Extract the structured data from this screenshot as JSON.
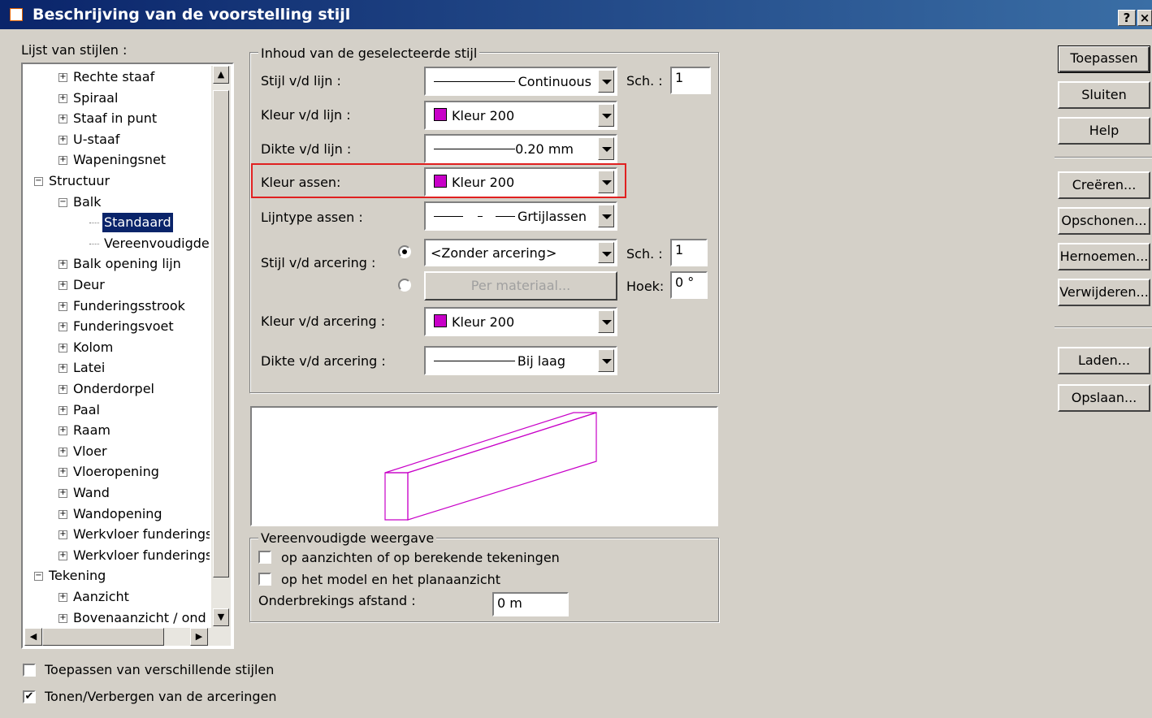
{
  "window": {
    "title": "Beschrijving van de voorstelling stijl",
    "help_btn": "?",
    "close_btn": "×"
  },
  "style_list": {
    "label": "Lijst van stijlen :",
    "items": [
      {
        "text": "Rechte staaf",
        "level": 2,
        "exp": "+"
      },
      {
        "text": "Spiraal",
        "level": 2,
        "exp": "+"
      },
      {
        "text": "Staaf in punt",
        "level": 2,
        "exp": "+"
      },
      {
        "text": "U-staaf",
        "level": 2,
        "exp": "+"
      },
      {
        "text": "Wapeningsnet",
        "level": 2,
        "exp": "+"
      },
      {
        "text": "Structuur",
        "level": 1,
        "exp": "−"
      },
      {
        "text": "Balk",
        "level": 2,
        "exp": "−"
      },
      {
        "text": "Standaard",
        "level": 3,
        "exp": "",
        "selected": true
      },
      {
        "text": "Vereenvoudigde",
        "level": 3,
        "exp": ""
      },
      {
        "text": "Balk opening lijn",
        "level": 2,
        "exp": "+"
      },
      {
        "text": "Deur",
        "level": 2,
        "exp": "+"
      },
      {
        "text": "Funderingsstrook",
        "level": 2,
        "exp": "+"
      },
      {
        "text": "Funderingsvoet",
        "level": 2,
        "exp": "+"
      },
      {
        "text": "Kolom",
        "level": 2,
        "exp": "+"
      },
      {
        "text": "Latei",
        "level": 2,
        "exp": "+"
      },
      {
        "text": "Onderdorpel",
        "level": 2,
        "exp": "+"
      },
      {
        "text": "Paal",
        "level": 2,
        "exp": "+"
      },
      {
        "text": "Raam",
        "level": 2,
        "exp": "+"
      },
      {
        "text": "Vloer",
        "level": 2,
        "exp": "+"
      },
      {
        "text": "Vloeropening",
        "level": 2,
        "exp": "+"
      },
      {
        "text": "Wand",
        "level": 2,
        "exp": "+"
      },
      {
        "text": "Wandopening",
        "level": 2,
        "exp": "+"
      },
      {
        "text": "Werkvloer funderings",
        "level": 2,
        "exp": "+"
      },
      {
        "text": "Werkvloer funderings",
        "level": 2,
        "exp": "+"
      },
      {
        "text": "Tekening",
        "level": 1,
        "exp": "−"
      },
      {
        "text": "Aanzicht",
        "level": 2,
        "exp": "+"
      },
      {
        "text": "Bovenaanzicht / ond",
        "level": 2,
        "exp": "+"
      }
    ]
  },
  "content": {
    "legend": "Inhoud van de geselecteerde stijl",
    "line_style": {
      "label": "Stijl v/d lijn :",
      "value": "Continuous"
    },
    "scale1": {
      "label": "Sch. :",
      "value": "1"
    },
    "line_color": {
      "label": "Kleur v/d lijn :",
      "value": "Kleur 200"
    },
    "line_thickness": {
      "label": "Dikte v/d lijn :",
      "value": "0.20 mm"
    },
    "axis_color": {
      "label": "Kleur assen:",
      "value": "Kleur 200"
    },
    "axis_linetype": {
      "label": "Lijntype assen :",
      "value": "Grtijlassen"
    },
    "hatch_style": {
      "label": "Stijl v/d arcering :",
      "value": "<Zonder arcering>",
      "per_material": "Per materiaal..."
    },
    "scale2": {
      "label": "Sch. :",
      "value": "1"
    },
    "angle": {
      "label": "Hoek:",
      "value": "0 °"
    },
    "hatch_color": {
      "label": "Kleur v/d arcering :",
      "value": "Kleur 200"
    },
    "hatch_thickness": {
      "label": "Dikte v/d arcering :",
      "value": "Bij laag"
    }
  },
  "simplified": {
    "legend": "Vereenvoudigde weergave",
    "check1": "op aanzichten of op berekende tekeningen",
    "check2": "op het model en het planaanzicht",
    "distance_label": "Onderbrekings afstand :",
    "distance_value": "0 m"
  },
  "buttons": {
    "apply": "Toepassen",
    "close": "Sluiten",
    "help": "Help",
    "create": "Creëren...",
    "clean": "Opschonen...",
    "rename": "Hernoemen...",
    "delete": "Verwijderen...",
    "load": "Laden...",
    "save": "Opslaan..."
  },
  "bottom": {
    "apply_different": "Toepassen van verschillende stijlen",
    "show_hide_hatch": "Tonen/Verbergen van de arceringen",
    "apply_different_checked": false,
    "show_hide_hatch_checked": true
  },
  "colors": {
    "preview": "#c800c8",
    "highlight": "#e02020"
  }
}
